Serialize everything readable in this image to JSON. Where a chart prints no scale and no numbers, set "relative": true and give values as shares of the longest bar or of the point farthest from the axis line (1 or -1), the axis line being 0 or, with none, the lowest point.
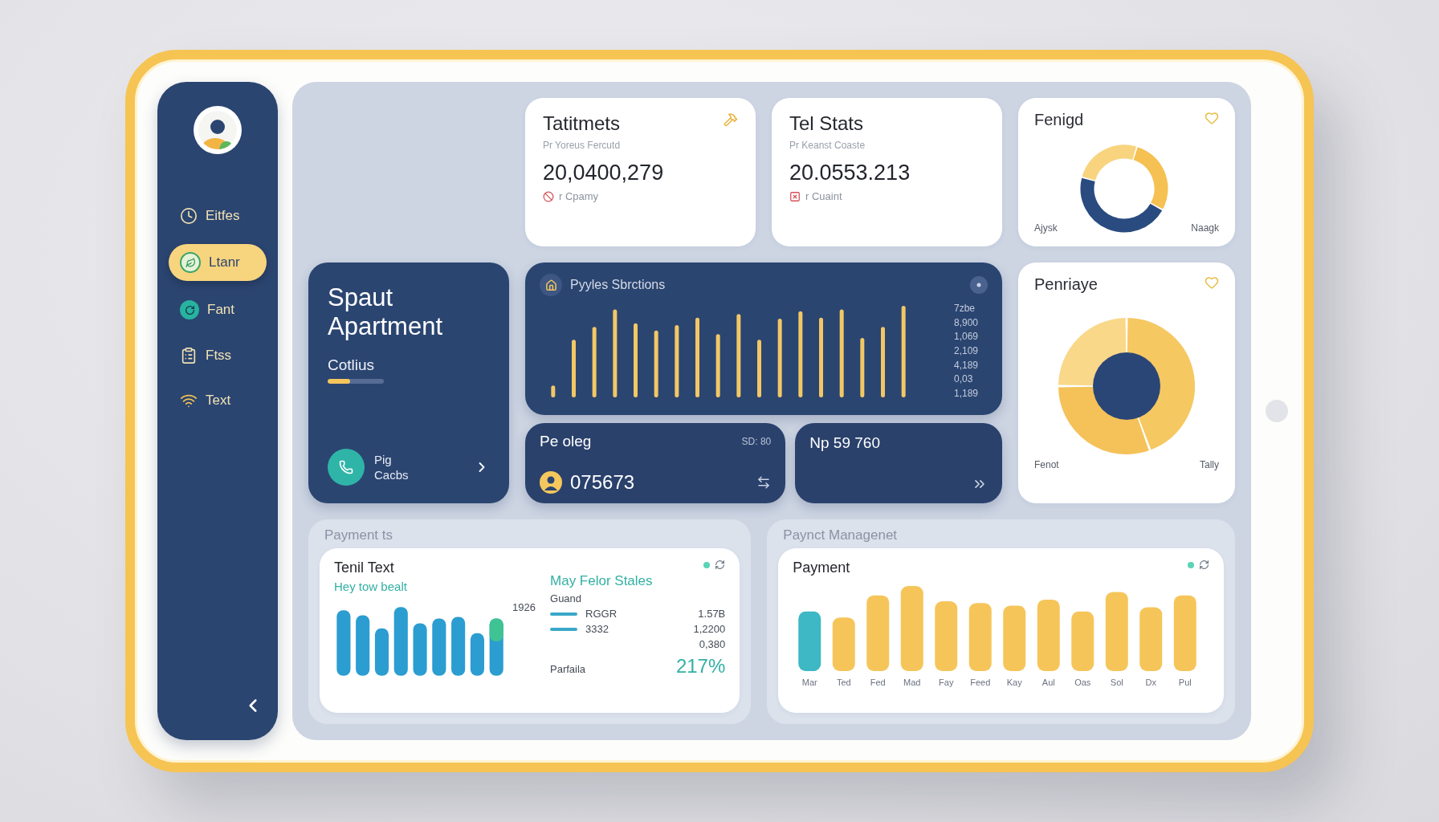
{
  "sidebar": {
    "items": [
      {
        "label": "Eitfes",
        "selected": false
      },
      {
        "label": "Ltanr",
        "selected": true
      },
      {
        "label": "Fant",
        "selected": false
      },
      {
        "label": "Ftss",
        "selected": false
      },
      {
        "label": "Text",
        "selected": false
      }
    ]
  },
  "stat_cards": [
    {
      "title": "Tatitmets",
      "subtitle": "Pr Yoreus Fercutd",
      "value": "20,0400,279",
      "note": "r Cpamy"
    },
    {
      "title": "Tel Stats",
      "subtitle": "Pr Keanst Coaste",
      "value": "20.0553.213",
      "note": "r Cuaint"
    }
  ],
  "donut_cards": [
    {
      "kind": "ring",
      "title": "Fenigd",
      "labels": [
        "Ajysk",
        "Naagk"
      ]
    },
    {
      "kind": "pie",
      "title": "Penriaye",
      "labels": [
        "Fenot",
        "Tally"
      ]
    }
  ],
  "apartment_card": {
    "title": "Spaut Apartment",
    "label": "Cotlius",
    "level": 0.4,
    "contact": "Pig Cacbs"
  },
  "activity_card": {
    "title": "Pyyles Sbrctions",
    "axis_labels": [
      "7zbe",
      "8,900",
      "1,069",
      "2,109",
      "4,189",
      "0,03",
      "1,189"
    ],
    "chart_data": {
      "type": "bar",
      "relative": true,
      "series": [
        {
          "color": "#f2c865",
          "values": [
            0.13,
            0.63,
            0.77,
            0.96,
            0.81,
            0.73,
            0.79,
            0.87,
            0.69,
            0.91,
            0.63,
            0.86,
            0.94,
            0.87,
            0.96,
            0.65,
            0.77,
            1.0
          ]
        }
      ]
    }
  },
  "balance_card": {
    "title": "Pe oleg",
    "value": "075673",
    "note": "SD: 80"
  },
  "total_card": {
    "title": "Np 59 760"
  },
  "payment_section": {
    "label": "Payment ts",
    "card": {
      "title": "Tenil Text",
      "subtitle": "Hey tow bealt",
      "bar_label": "1926",
      "side_title": "May Felor Stales",
      "side_label": "Guand",
      "legend": [
        {
          "code": "RGGR",
          "value": "1.57B"
        },
        {
          "code": "3332",
          "value": "1,2200"
        }
      ],
      "extra_value": "0,380",
      "footer_label": "Parfaila",
      "footer_value": "217%"
    }
  },
  "management_section": {
    "label": "Paynct Managenet",
    "card": {
      "title": "Payment",
      "chart_data": {
        "type": "bar",
        "relative": true,
        "stacked": true,
        "categories": [
          "Mar",
          "Ted",
          "Fed",
          "Mad",
          "Fay",
          "Feed",
          "Kay",
          "Aul",
          "Oas",
          "Sol",
          "Dx",
          "Pul"
        ],
        "series": [
          {
            "color": "#3db8c4",
            "values": [
              0.7,
              0,
              0,
              0,
              0,
              0,
              0,
              0,
              0,
              0,
              0,
              0
            ]
          },
          {
            "color": "#f6c55a",
            "values": [
              0,
              0.63,
              0.89,
              1.0,
              0.82,
              0.8,
              0.77,
              0.84,
              0.7,
              0.93,
              0.75,
              0.89
            ]
          }
        ]
      }
    }
  }
}
